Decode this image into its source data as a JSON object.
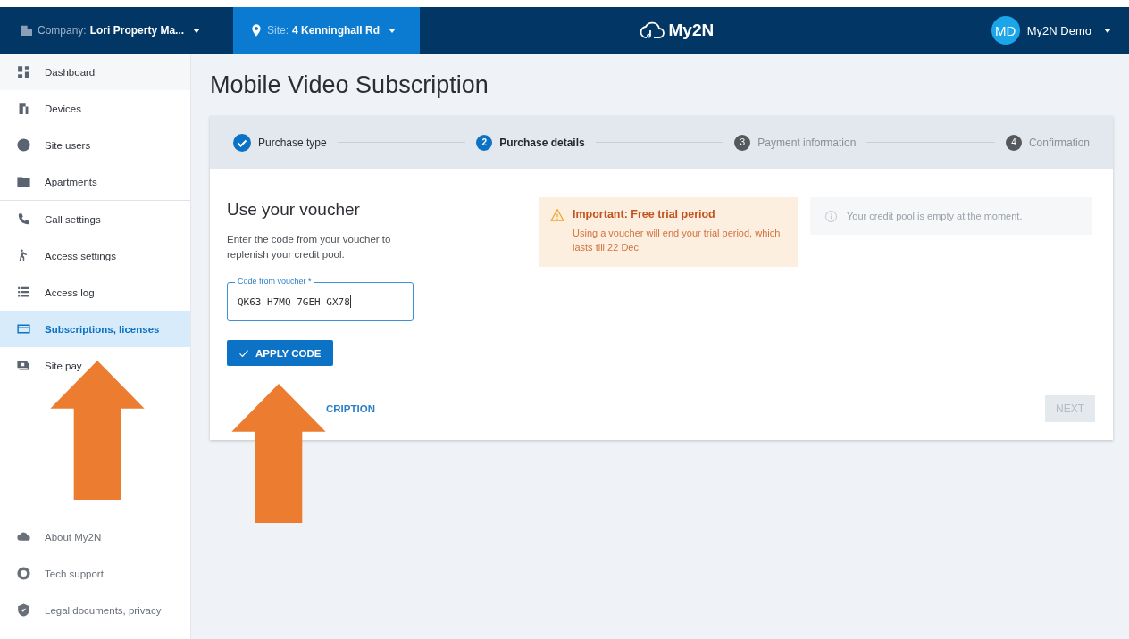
{
  "topbar": {
    "company": {
      "label": "Company:",
      "value": "Lori Property Ma..."
    },
    "site": {
      "label": "Site:",
      "value": "4 Kenninghall Rd"
    },
    "logo": "My2N",
    "user": {
      "initials": "MD",
      "name": "My2N Demo"
    }
  },
  "sidebar": {
    "items": [
      {
        "label": "Dashboard",
        "selected": false,
        "divider_after": false
      },
      {
        "label": "Devices",
        "selected": false,
        "divider_after": false
      },
      {
        "label": "Site users",
        "selected": false,
        "divider_after": false
      },
      {
        "label": "Apartments",
        "selected": false,
        "divider_after": true
      },
      {
        "label": "Call settings",
        "selected": false,
        "divider_after": false
      },
      {
        "label": "Access settings",
        "selected": false,
        "divider_after": false
      },
      {
        "label": "Access log",
        "selected": false,
        "divider_after": false
      },
      {
        "label": "Subscriptions, licenses",
        "selected": true,
        "divider_after": false
      },
      {
        "label": "Site pay",
        "selected": false,
        "divider_after": false
      }
    ],
    "footer": [
      {
        "label": "About My2N"
      },
      {
        "label": "Tech support"
      },
      {
        "label": "Legal documents, privacy"
      }
    ]
  },
  "page": {
    "title": "Mobile Video Subscription",
    "steps": [
      {
        "label": "Purchase type",
        "completed": true,
        "selected": false
      },
      {
        "number": "2",
        "label": "Purchase details",
        "completed": false,
        "selected": true
      },
      {
        "number": "3",
        "label": "Payment information",
        "completed": false,
        "selected": false
      },
      {
        "number": "4",
        "label": "Confirmation",
        "completed": false,
        "selected": false
      }
    ],
    "voucher": {
      "heading": "Use your voucher",
      "text": "Enter the code from your voucher to replenish your credit pool.",
      "field_label": "Code from voucher *",
      "value": "QK63-H7MQ-7GEH-GX78",
      "button": "APPLY CODE"
    },
    "warning": {
      "title": "Important: Free trial period",
      "text": "Using a voucher will end your trial period, which lasts till 22 Dec."
    },
    "info": "Your credit pool is empty at the moment.",
    "back_link": "CRIPTION",
    "next": {
      "label": "NEXT",
      "disabled": true
    }
  }
}
